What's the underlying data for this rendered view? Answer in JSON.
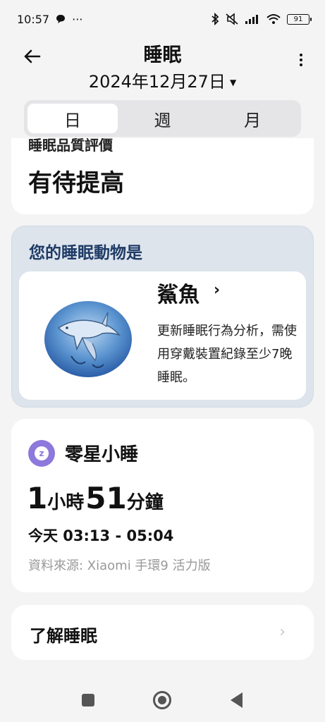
{
  "status": {
    "time": "10:57",
    "dots": "···",
    "battery": "91"
  },
  "header": {
    "title": "睡眠",
    "date": "2024年12月27日"
  },
  "tabs": [
    {
      "label": "日",
      "active": true
    },
    {
      "label": "週",
      "active": false
    },
    {
      "label": "月",
      "active": false
    }
  ],
  "quality": {
    "label": "睡眠品質評價",
    "value": "有待提高"
  },
  "animal": {
    "heading": "您的睡眠動物是",
    "name": "鯊魚",
    "chevron": "›",
    "description": "更新睡眠行為分析，需使用穿戴裝置紀錄至少7晚睡眠。"
  },
  "nap": {
    "title": "零星小睡",
    "hours": "1",
    "hours_unit": "小時",
    "minutes": "51",
    "minutes_unit": "分鐘",
    "range": "今天 03:13 - 05:04",
    "source": "資料來源: Xiaomi 手環9 活力版"
  },
  "learn": {
    "label": "了解睡眠",
    "chevron": "›"
  },
  "colors": {
    "background": "#f4f4f5",
    "animal_card": "#dde4ec",
    "animal_heading": "#1f3b66",
    "nap_icon": "#8d78db",
    "muted_text": "#999999"
  }
}
